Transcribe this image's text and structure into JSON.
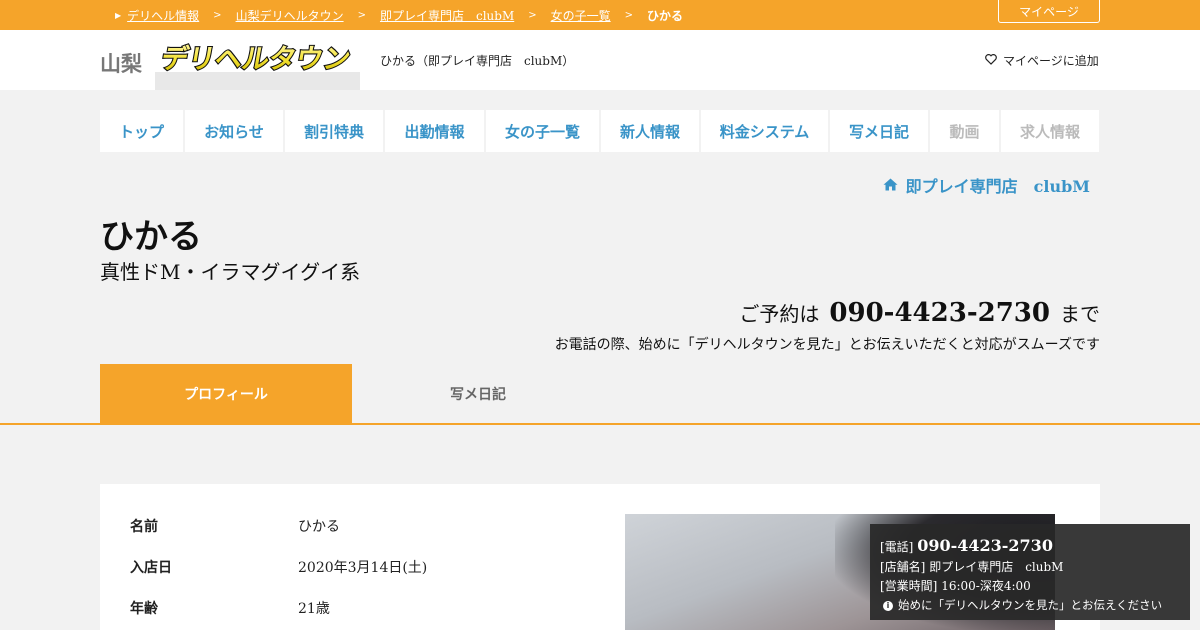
{
  "breadcrumb": {
    "items": [
      "デリヘル情報",
      "山梨デリヘルタウン",
      "即プレイ専門店　clubM",
      "女の子一覧"
    ],
    "current": "ひかる"
  },
  "mypage_label": "マイページ",
  "header": {
    "pref": "山梨",
    "logo_text": "デリヘルタウン",
    "shop_subtitle": "ひかる（即プレイ専門店　clubM）",
    "add_mypage": "マイページに追加"
  },
  "nav": {
    "items": [
      {
        "label": "トップ"
      },
      {
        "label": "お知らせ"
      },
      {
        "label": "割引特典"
      },
      {
        "label": "出勤情報"
      },
      {
        "label": "女の子一覧"
      },
      {
        "label": "新人情報"
      },
      {
        "label": "料金システム"
      },
      {
        "label": "写メ日記"
      },
      {
        "label": "動画"
      },
      {
        "label": "求人情報"
      }
    ]
  },
  "shop_link": "即プレイ専門店　clubM",
  "girl": {
    "name": "ひかる",
    "catch": "真性ドM・イラマグイグイ系"
  },
  "reserve": {
    "prefix": "ご予約は",
    "tel": "090-4423-2730",
    "suffix": "まで",
    "note": "お電話の際、始めに「デリヘルタウンを見た」とお伝えいただくと対応がスムーズです"
  },
  "tabs": {
    "profile": "プロフィール",
    "diary": "写メ日記"
  },
  "profile": {
    "rows": [
      {
        "key": "名前",
        "value": "ひかる"
      },
      {
        "key": "入店日",
        "value": "2020年3月14日(土)"
      },
      {
        "key": "年齢",
        "value": "21歳"
      }
    ]
  },
  "infobox": {
    "tel_label": "[電話]",
    "tel": "090-4423-2730",
    "shop_label": "[店舗名]",
    "shop": "即プレイ専門店　clubM",
    "hours_label": "[営業時間]",
    "hours": "16:00-深夜4:00",
    "hint": "始めに「デリヘルタウンを見た」とお伝えください"
  },
  "colors": {
    "accent": "#f5a42a",
    "link": "#3a94c8",
    "disabled": "#bbbbbb"
  }
}
